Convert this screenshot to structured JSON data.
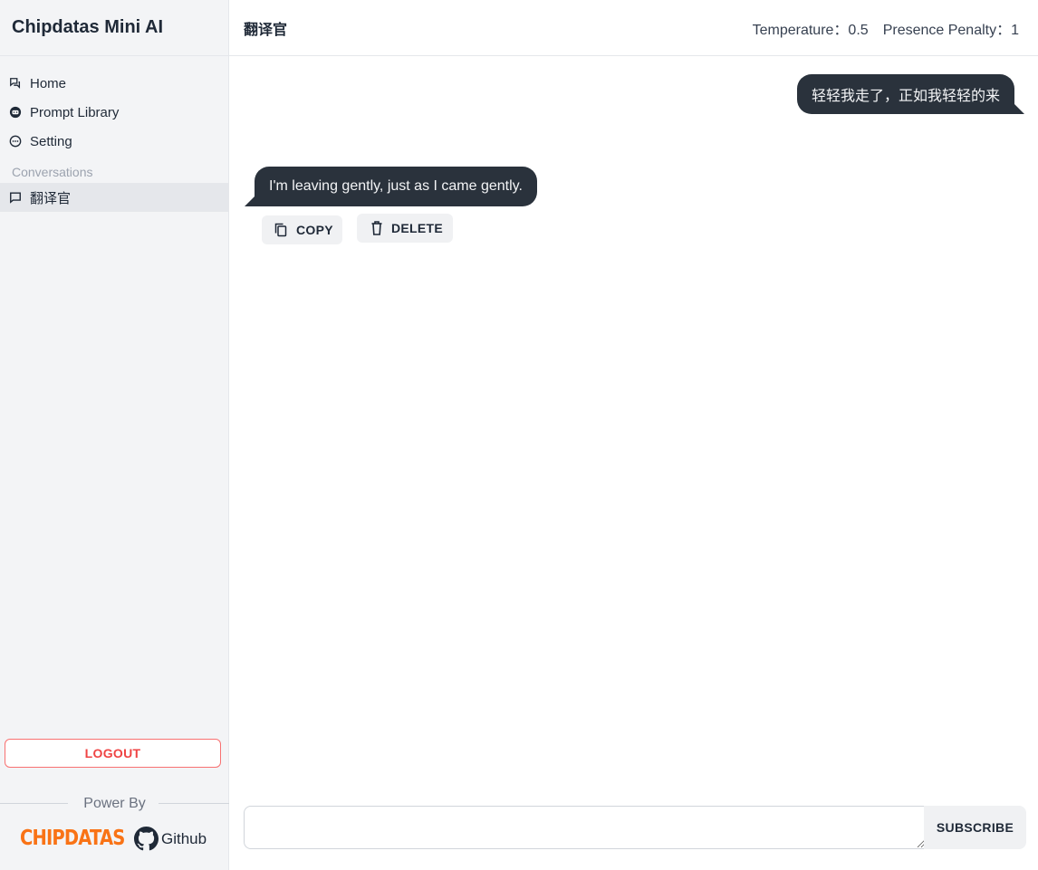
{
  "app": {
    "title": "Chipdatas Mini AI"
  },
  "sidebar": {
    "nav": [
      {
        "label": "Home",
        "icon": "chat-bubbles-icon"
      },
      {
        "label": "Prompt Library",
        "icon": "robot-icon"
      },
      {
        "label": "Setting",
        "icon": "dots-circle-icon"
      }
    ],
    "conversations_label": "Conversations",
    "conversations": [
      {
        "label": "翻译官",
        "icon": "message-square-icon",
        "selected": true
      }
    ],
    "logout_label": "LOGOUT",
    "power_by_label": "Power By",
    "brand_logo_text": "CHIPDATAS",
    "github_label": "Github"
  },
  "header": {
    "title": "翻译官",
    "temperature": "Temperature：0.5",
    "presence_penalty": "Presence Penalty：1"
  },
  "messages": [
    {
      "role": "user",
      "text": "轻轻我走了，正如我轻轻的来"
    },
    {
      "role": "assistant",
      "text": "I'm leaving gently, just as I came gently."
    }
  ],
  "actions": {
    "copy_label": "COPY",
    "delete_label": "DELETE"
  },
  "composer": {
    "value": "",
    "placeholder": "",
    "send_label": "SUBSCRIBE"
  },
  "colors": {
    "bubble": "#2a323c",
    "logout": "#ef4444",
    "brand_logo": "#f97316",
    "sidebar_bg": "#f3f4f6"
  }
}
